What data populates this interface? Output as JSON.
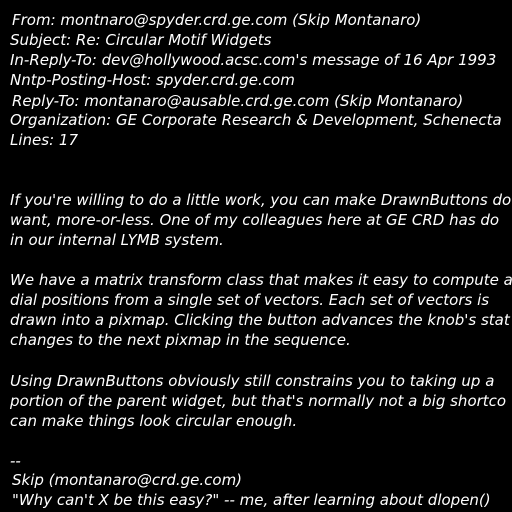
{
  "colors": {
    "background": "#000000",
    "text": "#ffffff"
  },
  "header": {
    "from": "From: montnaro@spyder.crd.ge.com (Skip Montanaro)",
    "subject": "Subject: Re: Circular Motif Widgets",
    "in_reply_to": "In-Reply-To: dev@hollywood.acsc.com's message of 16 Apr 1993",
    "nntp_posting_host": "Nntp-Posting-Host: spyder.crd.ge.com",
    "reply_to": "Reply-To: montanaro@ausable.crd.ge.com (Skip Montanaro)",
    "organization": "Organization: GE Corporate Research & Development, Schenecta",
    "lines": "Lines: 17"
  },
  "body": {
    "paragraph_1": [
      "If you're willing to do a little work, you can make DrawnButtons do",
      "want, more-or-less. One of my colleagues here at GE CRD has do",
      "in our internal LYMB system."
    ],
    "paragraph_2": [
      "We have a matrix transform class that makes it easy to compute a",
      "dial positions from a single set of vectors. Each set of vectors is",
      "drawn into a pixmap. Clicking the button advances the knob's stat",
      "changes to the next pixmap in the sequence."
    ],
    "paragraph_3": [
      "Using DrawnButtons obviously still constrains you to taking up a",
      "portion of the parent widget, but that's normally not a big shortco",
      "can make things look circular enough."
    ]
  },
  "signature": {
    "separator": "--",
    "name": "Skip (montanaro@crd.ge.com)",
    "quote": "\"Why can't X be this easy?\" -- me, after learning about dlopen()"
  }
}
